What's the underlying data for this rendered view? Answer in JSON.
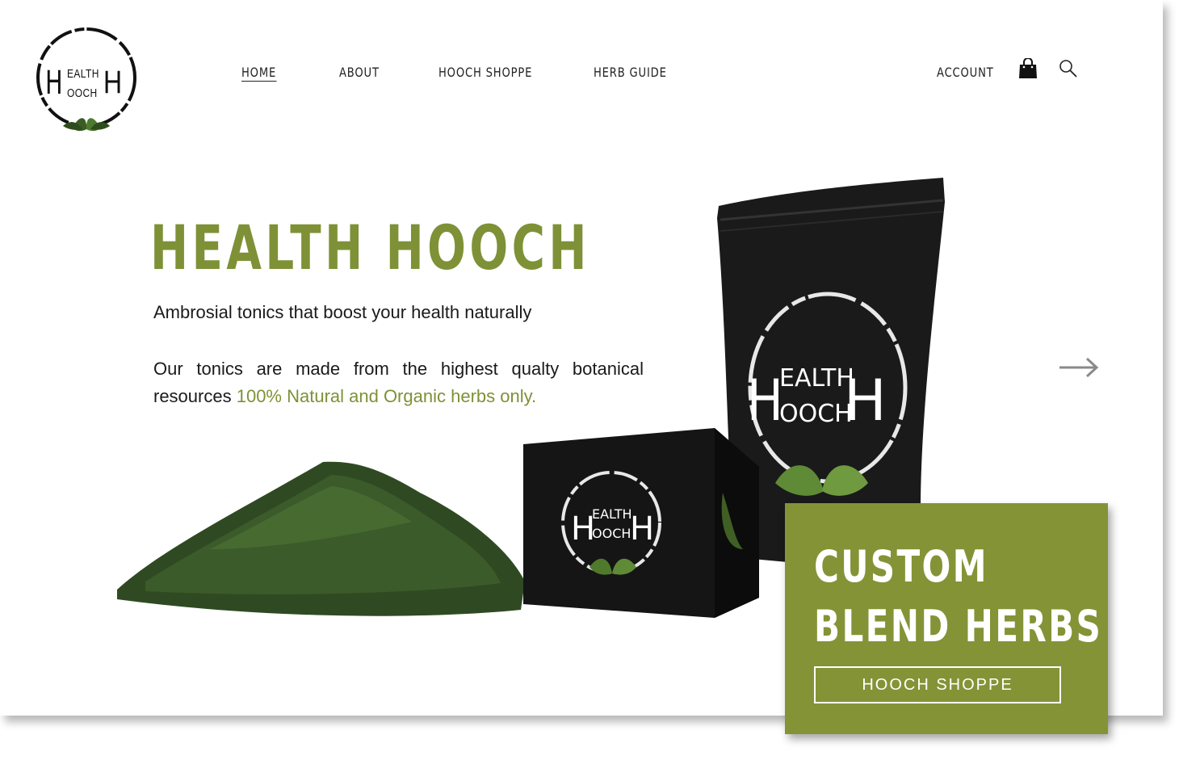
{
  "brand": {
    "logo_big_letter_left": "H",
    "logo_line1": "EALTH",
    "logo_line2": "OOCH",
    "logo_big_letter_right": "H"
  },
  "nav": {
    "items": [
      {
        "label": "HOME",
        "active": true
      },
      {
        "label": "ABOUT",
        "active": false
      },
      {
        "label": "HOOCH SHOPPE",
        "active": false
      },
      {
        "label": "HERB GUIDE",
        "active": false
      }
    ],
    "account_label": "ACCOUNT",
    "cart_icon": "shopping-bag-icon",
    "search_icon": "search-icon"
  },
  "hero": {
    "title": "HEALTH HOOCH",
    "tagline": "Ambrosial tonics that boost your health naturally",
    "description": "Our tonics are made from the highest qualty botanical resources",
    "description_highlight": "100% Natural and Organic herbs only.",
    "next_icon": "arrow-right-icon"
  },
  "promo": {
    "title_line1": "CUSTOM",
    "title_line2": "BLEND HERBS",
    "button_label": "HOOCH SHOPPE"
  },
  "colors": {
    "accent": "#7e9136",
    "card": "#849336",
    "text": "#1a1a1a"
  }
}
